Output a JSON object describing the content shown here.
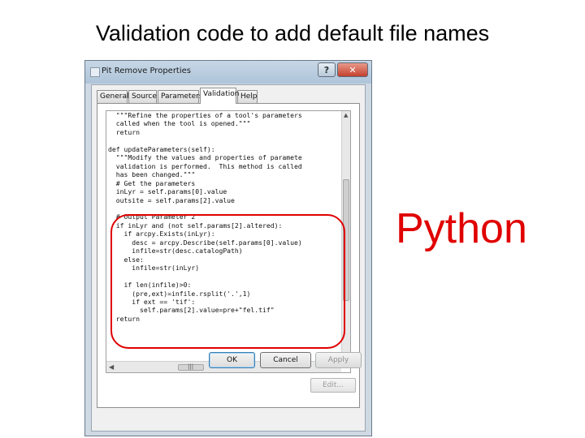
{
  "slide": {
    "title": "Validation code to add default file names",
    "annotation": "Python"
  },
  "dialog": {
    "title": "Pit Remove Properties",
    "help_button": "?",
    "close_button": "✕",
    "tabs": [
      "General",
      "Source",
      "Parameters",
      "Validation",
      "Help"
    ],
    "active_tab": "Validation",
    "code": [
      "  \"\"\"Refine the properties of a tool's parameters",
      "  called when the tool is opened.\"\"\"",
      "  return",
      "",
      "def updateParameters(self):",
      "  \"\"\"Modify the values and properties of paramete",
      "  validation is performed.  This method is called",
      "  has been changed.\"\"\"",
      "  # Get the parameters",
      "  inLyr = self.params[0].value",
      "  outsite = self.params[2].value",
      "",
      "  # Output Parameter 2",
      "  if inLyr and (not self.params[2].altered):",
      "    if arcpy.Exists(inLyr):",
      "      desc = arcpy.Describe(self.params[0].value)",
      "      infile=str(desc.catalogPath)",
      "    else:",
      "      infile=str(inLyr)",
      "",
      "    if len(infile)>0:",
      "      (pre,ext)=infile.rsplit('.',1)",
      "      if ext == 'tif':",
      "        self.params[2].value=pre+\"fel.tif\"",
      "  return"
    ],
    "scroll_up_arrow": "▲",
    "scroll_left_arrow": "◀",
    "scroll_grip": "|||",
    "edit_button": "Edit...",
    "ok_button": "OK",
    "cancel_button": "Cancel",
    "apply_button": "Apply"
  },
  "colors": {
    "highlight": "#e00000",
    "annotation": "#e00000"
  }
}
